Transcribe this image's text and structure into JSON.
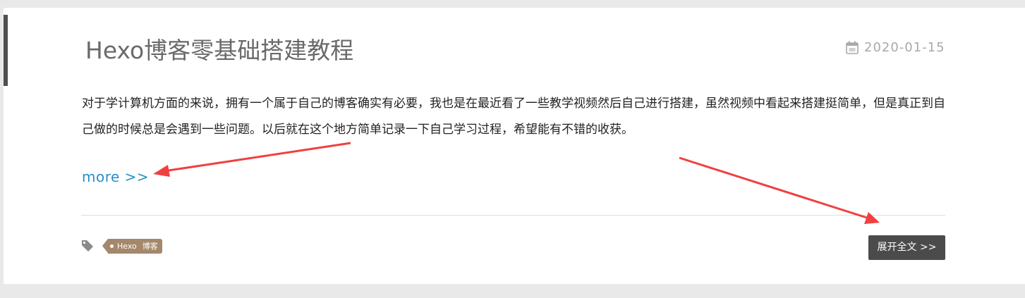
{
  "post": {
    "title": "Hexo博客零基础搭建教程",
    "date": "2020-01-15",
    "excerpt": "对于学计算机方面的来说，拥有一个属于自己的博客确实有必要，我也是在最近看了一些教学视频然后自己进行搭建，虽然视频中看起来搭建挺简单，但是真正到自己做的时候总是会遇到一些问题。以后就在这个地方简单记录一下自己学习过程，希望能有不错的收获。",
    "more_label": "more >>",
    "tags": [
      "Hexo",
      "博客"
    ],
    "expand_label": "展开全文 >>"
  },
  "icons": {
    "date": "calendar-icon",
    "tags": "tag-icon"
  },
  "colors": {
    "page_background": "#e9e9e9",
    "card_background": "#ffffff",
    "accent_bar": "#4f4f4f",
    "title": "#6a6a6a",
    "date": "#a9a9a9",
    "link": "#2a8fc7",
    "tag_background": "#a5876b",
    "button_background": "#4b4b4b",
    "annotation_arrow": "#f04040"
  }
}
